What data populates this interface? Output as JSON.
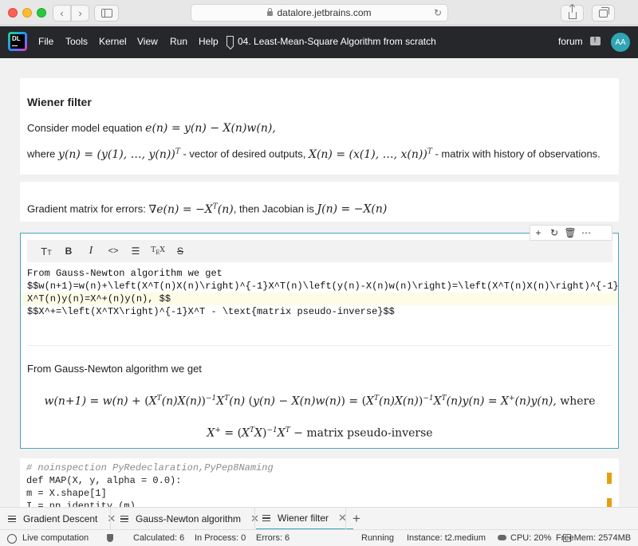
{
  "browser": {
    "url": "datalore.jetbrains.com"
  },
  "menu": {
    "items": [
      "File",
      "Tools",
      "Kernel",
      "View",
      "Run",
      "Help"
    ],
    "notebook_title": "04. Least-Mean-Square Algorithm from scratch",
    "forum": "forum",
    "avatar_initials": "AA"
  },
  "cell1": {
    "heading": "Wiener filter",
    "line1_text": "Consider model equation ",
    "line2_where": "where ",
    "line2_mid": " - vector of desired outputs, ",
    "line2_end": " - matrix with history of observations."
  },
  "cell2": {
    "text_a": "Gradient matrix for errors: ",
    "text_b": ", then Jacobian is "
  },
  "edit_cell": {
    "format_buttons": [
      "TT",
      "B",
      "I",
      "<>",
      "list",
      "TeX",
      "S"
    ],
    "source_lines": [
      "From Gauss-Newton algorithm we get",
      "$$w(n+1)=w(n)+\\left(X^T(n)X(n)\\right)^{-1}X^T(n)\\left(y(n)-X(n)w(n)\\right)=\\left(X^T(n)X(n)\\right)^{-1}",
      "X^T(n)y(n)=X^+(n)y(n), $$",
      "$$X^+=\\left(X^TX\\right)^{-1}X^T - \\text{matrix pseudo-inverse}$$"
    ],
    "rendered_intro": "From Gauss-Newton algorithm we get",
    "eq_where": "where",
    "eq_label": "matrix pseudo-inverse"
  },
  "code_cell": {
    "lines": [
      "# noinspection PyRedeclaration,PyPep8Naming",
      "def MAP(X, y, alpha = 0.0):",
      "    m = X.shape[1]",
      "    I = np.identity (m)"
    ]
  },
  "tabs": [
    {
      "label": "Gradient Descent",
      "active": false
    },
    {
      "label": "Gauss-Newton algorithm",
      "active": false
    },
    {
      "label": "Wiener filter",
      "active": true
    }
  ],
  "status": {
    "live": "Live computation",
    "calculated": "Calculated: 6",
    "in_process": "In Process: 0",
    "errors": "Errors: 6",
    "running": "Running",
    "instance": "Instance: t2.medium",
    "cpu": "CPU:  20%",
    "freemem": "FreeMem:  2574MB"
  },
  "colors": {
    "accent": "#2fa5b5",
    "menubar": "#26272a",
    "edit_border": "#4aa5bd"
  }
}
